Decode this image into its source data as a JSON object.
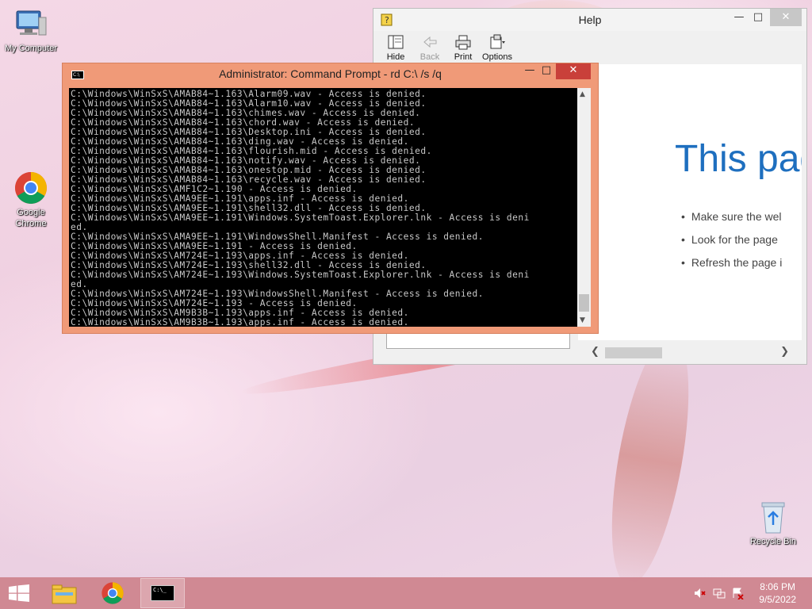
{
  "desktop": {
    "icons": [
      {
        "label": "My Computer"
      },
      {
        "label": "Google Chrome"
      },
      {
        "label": "Recycle Bin"
      }
    ]
  },
  "help_window": {
    "title": "Help",
    "toolbar": {
      "hide": "Hide",
      "back": "Back",
      "print": "Print",
      "options": "Options"
    },
    "content": {
      "heading": "This pag",
      "bullets": [
        "Make sure the wel",
        "Look for the page",
        "Refresh the page i"
      ]
    }
  },
  "cmd_window": {
    "title": "Administrator: Command Prompt - rd  C:\\ /s /q",
    "lines": [
      "C:\\Windows\\WinSxS\\AMAB84~1.163\\Alarm09.wav - Access is denied.",
      "C:\\Windows\\WinSxS\\AMAB84~1.163\\Alarm10.wav - Access is denied.",
      "C:\\Windows\\WinSxS\\AMAB84~1.163\\chimes.wav - Access is denied.",
      "C:\\Windows\\WinSxS\\AMAB84~1.163\\chord.wav - Access is denied.",
      "C:\\Windows\\WinSxS\\AMAB84~1.163\\Desktop.ini - Access is denied.",
      "C:\\Windows\\WinSxS\\AMAB84~1.163\\ding.wav - Access is denied.",
      "C:\\Windows\\WinSxS\\AMAB84~1.163\\flourish.mid - Access is denied.",
      "C:\\Windows\\WinSxS\\AMAB84~1.163\\notify.wav - Access is denied.",
      "C:\\Windows\\WinSxS\\AMAB84~1.163\\onestop.mid - Access is denied.",
      "C:\\Windows\\WinSxS\\AMAB84~1.163\\recycle.wav - Access is denied.",
      "C:\\Windows\\WinSxS\\AMF1C2~1.190 - Access is denied.",
      "C:\\Windows\\WinSxS\\AMA9EE~1.191\\apps.inf - Access is denied.",
      "C:\\Windows\\WinSxS\\AMA9EE~1.191\\shell32.dll - Access is denied.",
      "C:\\Windows\\WinSxS\\AMA9EE~1.191\\Windows.SystemToast.Explorer.lnk - Access is deni",
      "ed.",
      "C:\\Windows\\WinSxS\\AMA9EE~1.191\\WindowsShell.Manifest - Access is denied.",
      "C:\\Windows\\WinSxS\\AMA9EE~1.191 - Access is denied.",
      "C:\\Windows\\WinSxS\\AM724E~1.193\\apps.inf - Access is denied.",
      "C:\\Windows\\WinSxS\\AM724E~1.193\\shell32.dll - Access is denied.",
      "C:\\Windows\\WinSxS\\AM724E~1.193\\Windows.SystemToast.Explorer.lnk - Access is deni",
      "ed.",
      "C:\\Windows\\WinSxS\\AM724E~1.193\\WindowsShell.Manifest - Access is denied.",
      "C:\\Windows\\WinSxS\\AM724E~1.193 - Access is denied.",
      "C:\\Windows\\WinSxS\\AM9B3B~1.193\\apps.inf - Access is denied.",
      "C:\\Windows\\WinSxS\\AM9B3B~1.193\\apps.inf - Access is denied."
    ]
  },
  "taskbar": {
    "clock_time": "8:06 PM",
    "clock_date": "9/5/2022"
  },
  "colors": {
    "cmd_frame": "#f09a78",
    "close_button": "#c9403a",
    "help_heading": "#1e6fbf",
    "taskbar": "#cd828c"
  }
}
